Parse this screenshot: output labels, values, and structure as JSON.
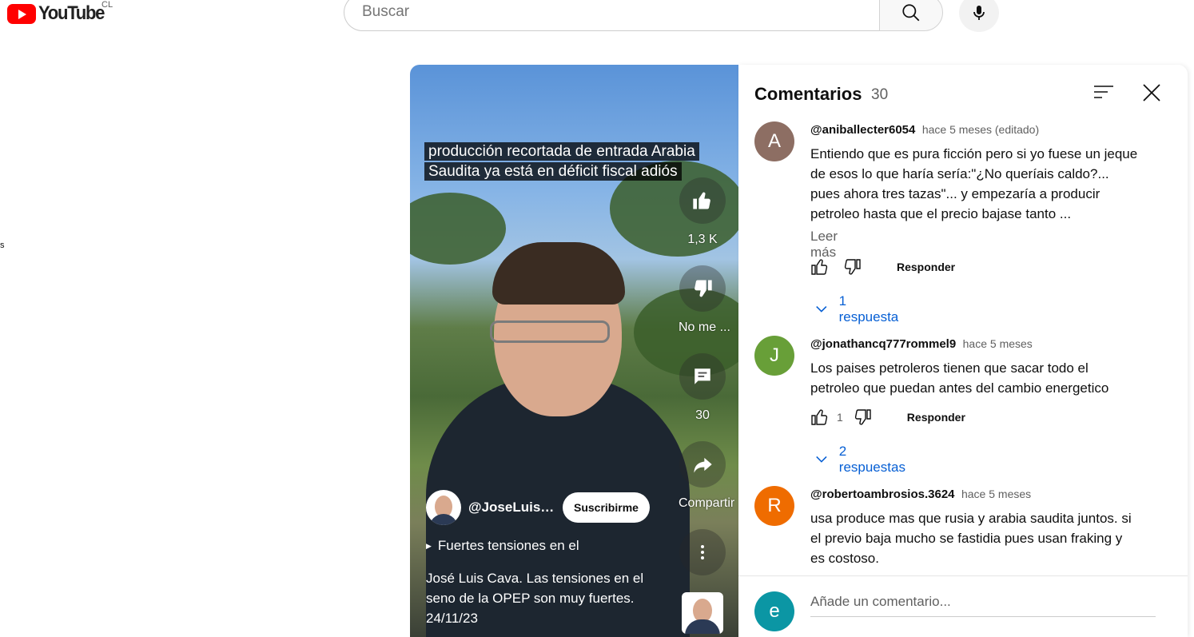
{
  "header": {
    "logo_text": "YouTube",
    "country": "CL",
    "search_placeholder": "Buscar",
    "left_stub": "s"
  },
  "short": {
    "caption": "producción recortada de entrada Arabia Saudita ya está en déficit fiscal adiós",
    "likes_label": "1,3 K",
    "dislike_label": "No me ...",
    "comments_label": "30",
    "share_label": "Compartir",
    "channel_name": "@JoseLuisCava",
    "subscribe_label": "Suscribirme",
    "playlist_label": "Fuertes tensiones en el",
    "description": "José Luis Cava. Las tensiones en el seno de la OPEP son muy fuertes. 24/11/23"
  },
  "comments_panel": {
    "title": "Comentarios",
    "count": "30",
    "add_placeholder": "Añade un comentario...",
    "current_user_initial": "e",
    "comments": [
      {
        "initial": "A",
        "color": "#8d6e63",
        "author": "@aniballecter6054",
        "time": "hace 5 meses (editado)",
        "text": "Entiendo que es pura ficción pero si yo fuese un jeque de esos lo que haría sería:\"¿No queríais caldo?... pues ahora tres tazas\"... y empezaría a producir petroleo hasta que el precio bajase tanto ...",
        "read_more": "Leer más",
        "likes": "",
        "reply_label": "Responder",
        "replies_label": "1 respuesta"
      },
      {
        "initial": "J",
        "color": "#689f38",
        "author": "@jonathancq777rommel9",
        "time": "hace 5 meses",
        "text": "Los paises petroleros tienen que sacar todo el petroleo que puedan antes del cambio energetico",
        "likes": "1",
        "reply_label": "Responder",
        "replies_label": "2 respuestas"
      },
      {
        "initial": "R",
        "color": "#ef6c00",
        "author": "@robertoambrosios.3624",
        "time": "hace 5 meses",
        "text": "usa produce mas que rusia y arabia saudita juntos. si el previo baja mucho se fastidia pues usan fraking y es costoso."
      }
    ]
  }
}
